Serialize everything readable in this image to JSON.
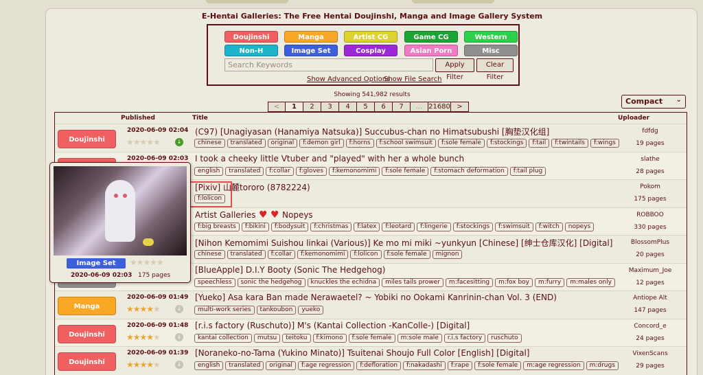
{
  "site_title": "E-Hentai Galleries: The Free Hentai Doujinshi, Manga and Image Gallery System",
  "categories": [
    {
      "label": "Doujinshi",
      "color": "#f06060"
    },
    {
      "label": "Manga",
      "color": "#f9a825"
    },
    {
      "label": "Artist CG",
      "color": "#dcd32e"
    },
    {
      "label": "Game CG",
      "color": "#1aa535"
    },
    {
      "label": "Western",
      "color": "#2bd14b"
    },
    {
      "label": "Non-H",
      "color": "#1db3c8"
    },
    {
      "label": "Image Set",
      "color": "#3d5fdc"
    },
    {
      "label": "Cosplay",
      "color": "#9b29d6"
    },
    {
      "label": "Asian Porn",
      "color": "#f07ac4"
    },
    {
      "label": "Misc",
      "color": "#8f8f8f"
    }
  ],
  "search": {
    "placeholder": "Search Keywords",
    "apply_label": "Apply Filter",
    "clear_label": "Clear Filter",
    "advanced_link": "Show Advanced Options",
    "file_search_link": "Show File Search"
  },
  "results_text": "Showing 541,982 results",
  "pager": [
    "<",
    "1",
    "2",
    "3",
    "4",
    "5",
    "6",
    "7",
    "...",
    "21680",
    ">"
  ],
  "display_mode": "Compact",
  "table_headers": {
    "published": "Published",
    "title": "Title",
    "uploader": "Uploader"
  },
  "rows": [
    {
      "category": "Doujinshi",
      "cat_color": "#f06060",
      "date": "2020-06-09 02:04",
      "rating": 0,
      "title": "(C97) [Unagiyasan (Hanamiya Natsuka)] Succubus-chan no Himatsubushi [胸垫汉化组]",
      "tags": [
        "chinese",
        "translated",
        "original",
        "f:demon girl",
        "f:horns",
        "f:school swimsuit",
        "f:sole female",
        "f:stockings",
        "f:tail",
        "f:twintails",
        "f:wings"
      ],
      "uploader": "fdfdg",
      "pages": "19 pages"
    },
    {
      "category": "",
      "cat_color": "#f06060",
      "date": "2020-06-09 02:03",
      "rating": 0,
      "title": "I took a cheeky little Vtuber and \"played\" with her a whole bunch",
      "tags": [
        "english",
        "translated",
        "f:collar",
        "f:gloves",
        "f:kemonomimi",
        "f:sole female",
        "f:stomach deformation",
        "f:tail plug"
      ],
      "uploader": "slathe",
      "pages": "28 pages"
    },
    {
      "category": "",
      "cat_color": "#3d5fdc",
      "date": "",
      "rating": 0,
      "title": "[Pixiv] 山麓tororo (8782224)",
      "tags": [
        "f:lolicon"
      ],
      "uploader": "Pokom",
      "pages": "175 pages"
    },
    {
      "category": "",
      "cat_color": "#dcd32e",
      "date": "",
      "rating": 0,
      "title": "Artist Galleries",
      "title_extra": "Nopeys",
      "tags": [
        "f:big breasts",
        "f:bikini",
        "f:bodysuit",
        "f:christmas",
        "f:latex",
        "f:leotard",
        "f:lingerie",
        "f:stockings",
        "f:swimsuit",
        "f:witch",
        "nopeys"
      ],
      "uploader": "ROBBOO",
      "pages": "330 pages"
    },
    {
      "category": "",
      "cat_color": "#f06060",
      "date": "",
      "rating": 0,
      "title": "[Nihon Kemomimi Suishou linkai (Various)] Ke mo mi miki ~yunkyun [Chinese] [绅士仓库汉化] [Digital]",
      "tags": [
        "chinese",
        "translated",
        "f:collar",
        "f:kemonomimi",
        "f:lolicon",
        "f:sole female",
        "mignon"
      ],
      "uploader": "BlossomPlus",
      "pages": "20 pages"
    },
    {
      "category": "",
      "cat_color": "#8f8f8f",
      "date": "",
      "rating": 0,
      "title": "[BlueApple] D.I.Y Booty (Sonic The Hedgehog)",
      "tags": [
        "speechless",
        "sonic the hedgehog",
        "knuckles the echidna",
        "miles tails prower",
        "m:facesitting",
        "m:fox boy",
        "m:furry",
        "m:males only"
      ],
      "uploader": "Maximum_Joe",
      "pages": "12 pages"
    },
    {
      "category": "Manga",
      "cat_color": "#f9a825",
      "date": "2020-06-09 01:49",
      "rating": 4,
      "title": "[Yueko] Asa kara Ban made Nerawaetel? ~ Yobiki no Ookami Kanrinin-chan Vol. 3 (END)",
      "tags": [
        "multi-work series",
        "tankoubon",
        "yueko"
      ],
      "uploader": "Antiope Alt",
      "pages": "147 pages"
    },
    {
      "category": "Doujinshi",
      "cat_color": "#f06060",
      "date": "2020-06-09 01:48",
      "rating": 4,
      "title": "[r.i.s factory (Ruschuto)] M's (Kantai Collection -KanColle-) [Digital]",
      "tags": [
        "kantai collection",
        "mutsu",
        "teitoku",
        "f:kimono",
        "f:sole female",
        "m:sole male",
        "r.i.s factory",
        "ruschuto"
      ],
      "uploader": "Concord_e",
      "pages": "24 pages"
    },
    {
      "category": "Doujinshi",
      "cat_color": "#f06060",
      "date": "2020-06-09 01:39",
      "rating": 4,
      "title": "[Noraneko-no-Tama (Yukino Minato)] Tsuitenai Shoujo Full Color [English] [Digital]",
      "tags": [
        "english",
        "translated",
        "original",
        "f:age regression",
        "f:defloration",
        "f:nakadashi",
        "f:rape",
        "f:sole female",
        "m:age regression",
        "m:drugs"
      ],
      "uploader": "VixenScans",
      "pages": "29 pages"
    }
  ],
  "popup": {
    "category": "Image Set",
    "date": "2020-06-09 02:03",
    "pages": "175 pages"
  }
}
